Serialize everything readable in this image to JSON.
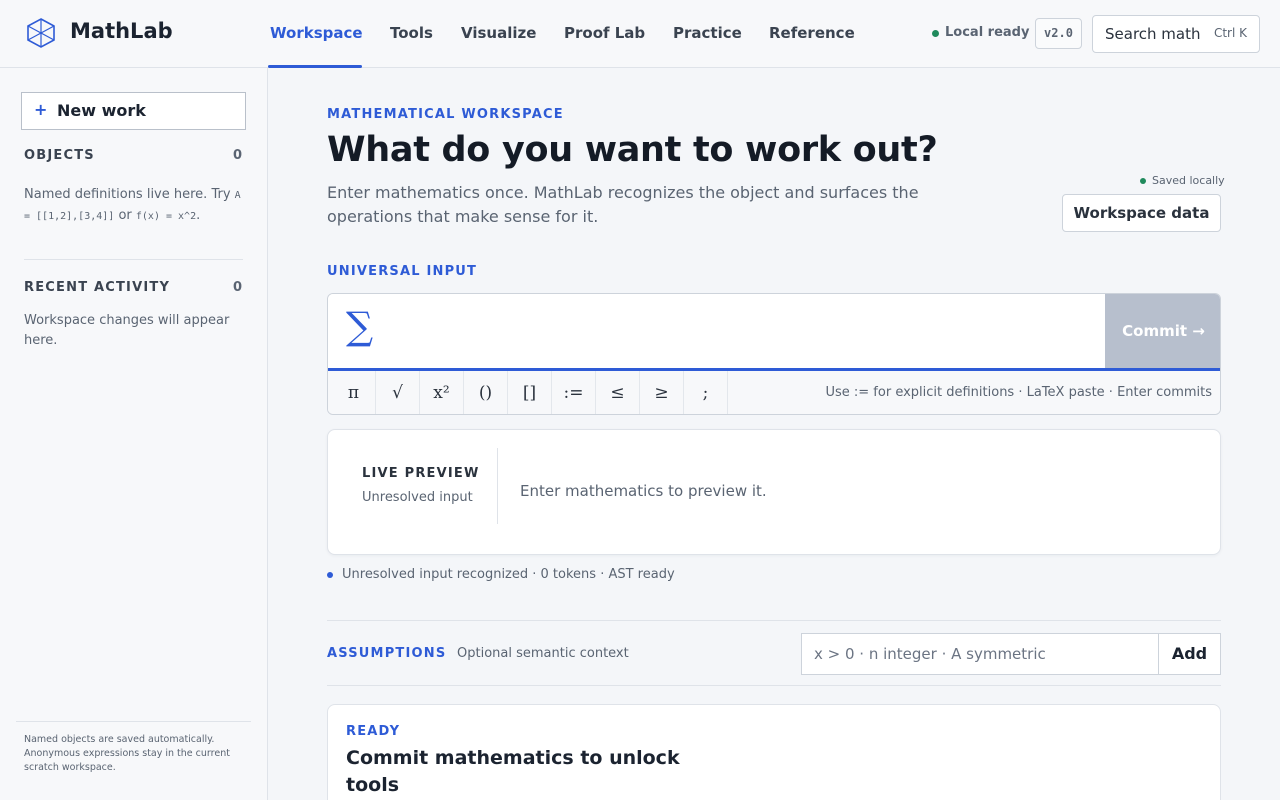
{
  "app": {
    "brand": "MathLab",
    "status": "Local ready",
    "version": "v2.0",
    "search_label": "Search math",
    "search_shortcut": "Ctrl K",
    "accent_color": "#2e5bd6"
  },
  "nav": {
    "items": [
      {
        "label": "Workspace",
        "active": true
      },
      {
        "label": "Tools"
      },
      {
        "label": "Visualize"
      },
      {
        "label": "Proof Lab"
      },
      {
        "label": "Practice"
      },
      {
        "label": "Reference"
      }
    ]
  },
  "sidebar": {
    "new_work": "New work",
    "objects": {
      "heading": "OBJECTS",
      "count": "0",
      "help_prefix": "Named definitions live here. Try ",
      "example_a": "A = [[1,2],[3,4]]",
      "help_or": " or ",
      "example_f": "f(x) = x^2",
      "help_suffix": "."
    },
    "recent": {
      "heading": "RECENT ACTIVITY",
      "count": "0",
      "help": "Workspace changes will appear here."
    },
    "footer": "Named objects are saved automatically. Anonymous expressions stay in the current scratch workspace."
  },
  "main": {
    "eyebrow": "MATHEMATICAL WORKSPACE",
    "headline": "What do you want to work out?",
    "subtitle": "Enter mathematics once. MathLab recognizes the object and surfaces the operations that make sense for it.",
    "saved_status": "Saved locally",
    "workspace_data_button": "Workspace data",
    "universal_input": {
      "label": "UNIVERSAL INPUT",
      "sigma": "∑",
      "value": "",
      "commit": "Commit  →",
      "symbols": [
        "π",
        "√",
        "x²",
        "()",
        "[]",
        ":=",
        "≤",
        "≥",
        ";"
      ],
      "hint": "Use := for explicit definitions · LaTeX paste · Enter commits"
    },
    "preview": {
      "title": "LIVE PREVIEW",
      "subtitle": "Unresolved input",
      "text": "Enter mathematics to preview it."
    },
    "status_line": "Unresolved input recognized · 0 tokens · AST ready",
    "assumptions": {
      "label": "ASSUMPTIONS",
      "sub": "Optional semantic context",
      "placeholder": "x > 0 · n integer · A symmetric",
      "add": "Add"
    },
    "ready": {
      "label": "READY",
      "title": "Commit mathematics to unlock tools"
    }
  }
}
